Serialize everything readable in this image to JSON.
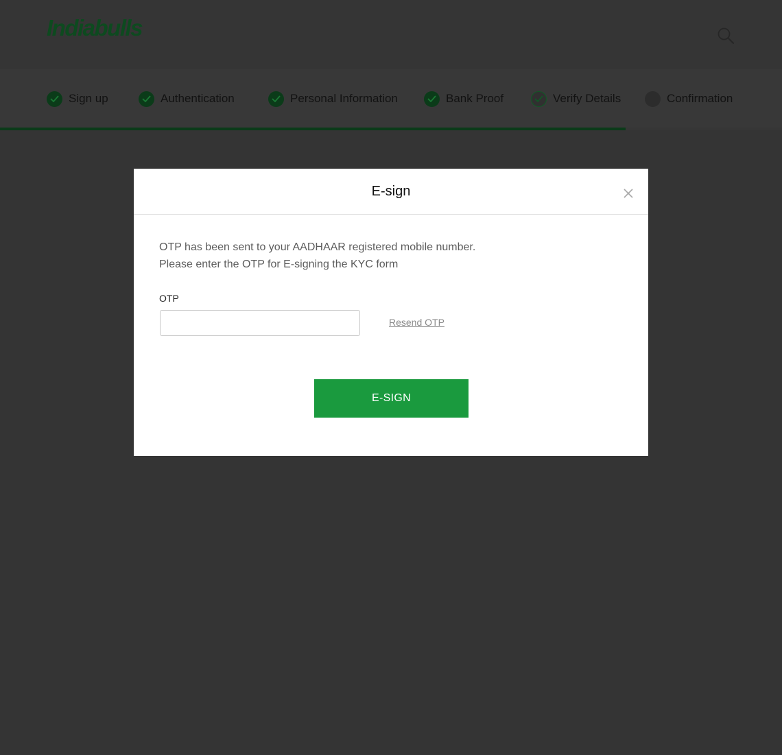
{
  "brand": {
    "logo_text": "Indiabulls",
    "logo_color": "#0d4a1f"
  },
  "header": {
    "search_icon": "search-icon"
  },
  "steps": {
    "items": [
      {
        "label": "Sign up",
        "status": "done"
      },
      {
        "label": "Authentication",
        "status": "done"
      },
      {
        "label": "Personal Information",
        "status": "done"
      },
      {
        "label": "Bank Proof",
        "status": "done"
      },
      {
        "label": "Verify Details",
        "status": "current"
      },
      {
        "label": "Confirmation",
        "status": "pending"
      }
    ],
    "progress_fraction": 0.8,
    "progress_color": "#0b3b19"
  },
  "modal": {
    "title": "E-sign",
    "close_icon": "close-icon",
    "message_line1": "OTP has been sent to your AADHAAR registered mobile number.",
    "message_line2": "Please enter the OTP for E-signing the KYC form",
    "otp_label": "OTP",
    "otp_value": "",
    "otp_placeholder": "",
    "resend_label": "Resend OTP",
    "submit_label": "E-SIGN",
    "submit_color": "#1a9a3e"
  }
}
